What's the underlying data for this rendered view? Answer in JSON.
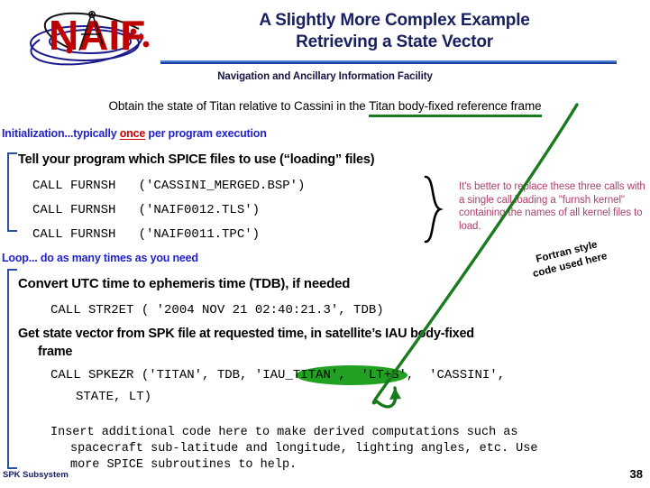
{
  "logo": {
    "wordmark": "NAIF",
    "alt": "naif-logo"
  },
  "header": {
    "title_line_1": "A Slightly More Complex Example",
    "title_line_2": "Retrieving a State Vector",
    "subtitle": "Navigation and Ancillary Information Facility",
    "rule_color": "#1f3f9e"
  },
  "objective": {
    "text_plain": "Obtain the state of Titan relative to Cassini in the ",
    "text_underlined": "Titan body-fixed reference frame",
    "underline_color": "#1a7a1e"
  },
  "init_section": {
    "label_before": "Initialization...typically ",
    "label_accent": "once",
    "label_after": " per program execution",
    "accent_color": "#cc0000",
    "label_color": "#2222cc",
    "heading": "Tell your program which SPICE files to use (“loading” files)",
    "code_lines": [
      "CALL FURNSH   ('CASSINI_MERGED.BSP')",
      "CALL FURNSH   ('NAIF0012.TLS')",
      "CALL FURNSH   ('NAIF0011.TPC')"
    ]
  },
  "red_note": {
    "text": "It's better to replace these three calls with a single call loading a \"furnsh kernel\" containing the names of all kernel files to load.",
    "color": "#b0406a"
  },
  "fortran_label": {
    "line_1": "Fortran style",
    "line_2": "code used here"
  },
  "loop_section": {
    "label": "Loop... do as many times as you need",
    "label_color": "#2222cc",
    "convert_heading": "Convert UTC time to ephemeris time (TDB), if needed",
    "convert_code": "CALL STR2ET ( '2004 NOV 21 02:40:21.3', TDB)",
    "getstate_heading_line_1": "Get state vector from SPK file at requested time, in satellite’s IAU body-fixed",
    "getstate_heading_line_2": "frame",
    "spkezr_prefix": "CALL SPKEZR ('TITAN', TDB, ",
    "spkezr_highlight": "'IAU_TITAN'",
    "spkezr_suffix": ",  'LT+S',  'CASSINI',",
    "spkezr_line_2": "STATE, LT)",
    "highlight_color": "#22a022"
  },
  "insert_note": {
    "line_1": "Insert additional code here to make derived computations such as",
    "line_2": "spacecraft sub-latitude and longitude, lighting angles, etc. Use",
    "line_3": "more SPICE subroutines to help."
  },
  "footer": {
    "left": "SPK Subsystem",
    "page": "38"
  }
}
